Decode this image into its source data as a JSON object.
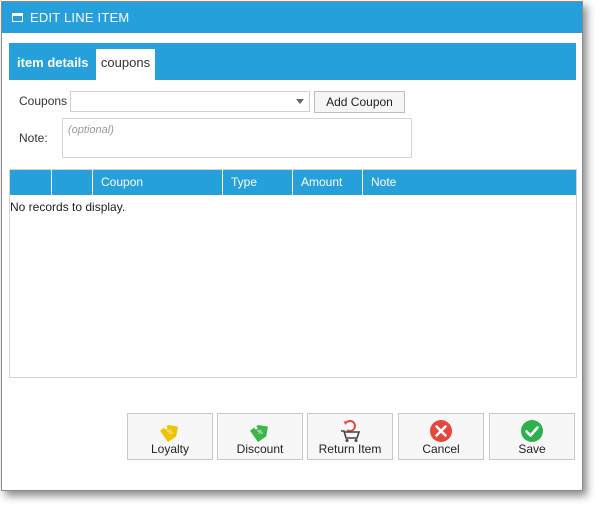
{
  "window": {
    "title": "EDIT LINE ITEM"
  },
  "tabs": [
    {
      "label": "item details",
      "selected": false
    },
    {
      "label": "coupons",
      "selected": true
    }
  ],
  "form": {
    "coupons_label": "Coupons",
    "coupons_value": "",
    "add_coupon_label": "Add Coupon",
    "note_label": "Note:",
    "note_placeholder": "(optional)"
  },
  "grid": {
    "columns": [
      "",
      "",
      "Coupon",
      "Type",
      "Amount",
      "Note"
    ],
    "empty_text": "No records to display."
  },
  "actions": [
    {
      "label": "Loyalty",
      "icon": "loyalty-tag-icon"
    },
    {
      "label": "Discount",
      "icon": "discount-tag-icon"
    },
    {
      "label": "Return Item",
      "icon": "return-cart-icon"
    },
    {
      "label": "Cancel",
      "icon": "cancel-icon"
    },
    {
      "label": "Save",
      "icon": "save-check-icon"
    }
  ],
  "colors": {
    "accent": "#26a0da",
    "loyalty": "#f2c200",
    "discount": "#3cb64a",
    "cancel": "#e8453c",
    "save": "#2eb14a"
  }
}
